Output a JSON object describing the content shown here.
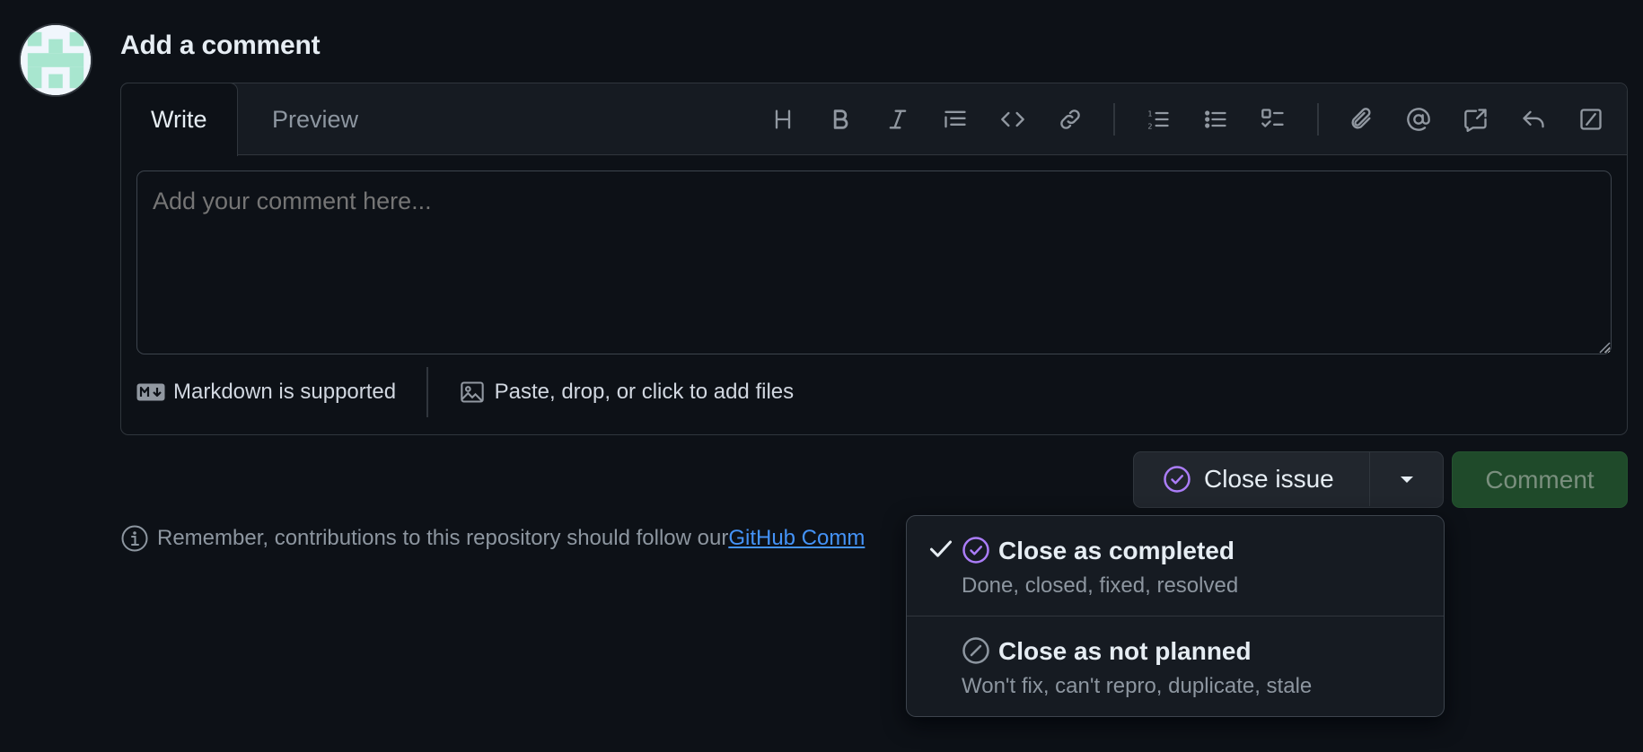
{
  "heading": "Add a comment",
  "tabs": {
    "write": "Write",
    "preview": "Preview"
  },
  "toolbar": [
    "heading-icon",
    "bold-icon",
    "italic-icon",
    "quote-icon",
    "code-icon",
    "link-icon",
    "ordered-list-icon",
    "unordered-list-icon",
    "task-list-icon",
    "attach-icon",
    "mention-icon",
    "cross-reference-icon",
    "reply-icon",
    "slash-commands-icon"
  ],
  "editor": {
    "placeholder": "Add your comment here..."
  },
  "footer": {
    "markdown_label": "Markdown is supported",
    "files_label": "Paste, drop, or click to add files"
  },
  "actions": {
    "close_issue": "Close issue",
    "comment": "Comment"
  },
  "notice": {
    "text": "Remember, contributions to this repository should follow our ",
    "link": "GitHub Comm"
  },
  "close_menu": {
    "items": [
      {
        "title": "Close as completed",
        "description": "Done, closed, fixed, resolved",
        "selected": true
      },
      {
        "title": "Close as not planned",
        "description": "Won't fix, can't repro, duplicate, stale",
        "selected": false
      }
    ]
  },
  "colors": {
    "background": "#0d1117",
    "completed_purple": "#ab7df8",
    "link_blue": "#4493f8",
    "comment_green": "#1f4a2a"
  }
}
